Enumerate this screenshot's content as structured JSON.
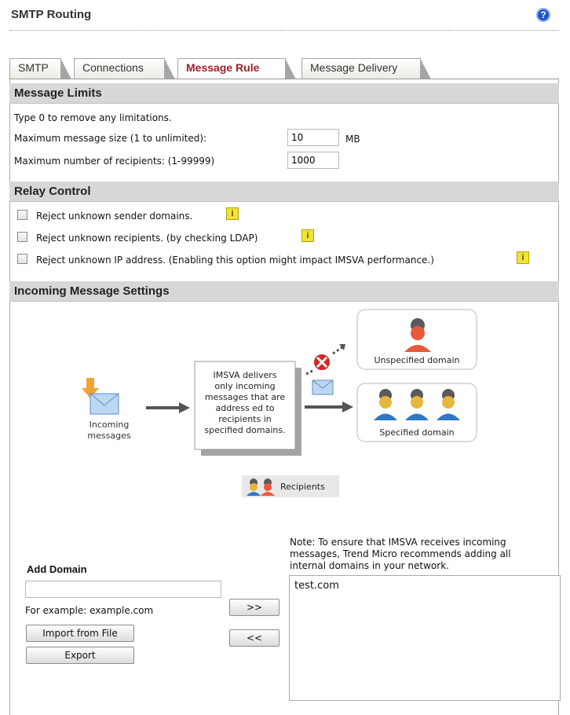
{
  "page": {
    "title": "SMTP Routing",
    "help_icon": "help-icon",
    "help_glyph": "?"
  },
  "tabs": [
    {
      "label": "SMTP"
    },
    {
      "label": "Connections"
    },
    {
      "label": "Message Rule",
      "active": true
    },
    {
      "label": "Message Delivery"
    }
  ],
  "message_limits": {
    "heading": "Message Limits",
    "hint": "Type 0 to remove any limitations.",
    "max_size_label": "Maximum message size (1 to unlimited):",
    "max_size_value": "10",
    "max_size_unit": "MB",
    "max_recipients_label": "Maximum number of recipients: (1-99999)",
    "max_recipients_value": "1000"
  },
  "relay_control": {
    "heading": "Relay Control",
    "options": [
      {
        "label": "Reject unknown sender domains.",
        "checked": false
      },
      {
        "label": "Reject unknown recipients. (by checking LDAP)",
        "checked": false
      },
      {
        "label": "Reject unknown IP address. (Enabling this option might impact IMSVA performance.)",
        "checked": false
      }
    ],
    "tip_glyph": "i"
  },
  "incoming": {
    "heading": "Incoming Message Settings",
    "diagram": {
      "incoming_label_1": "Incoming",
      "incoming_label_2": "messages",
      "center_lines": [
        "IMSVA delivers",
        "only incoming",
        "messages that are",
        "address ed to",
        "recipients in",
        "specified domains."
      ],
      "unspecified_label": "Unspecified domain",
      "specified_label": "Specified domain",
      "legend_label": "Recipients"
    },
    "add_domain_label": "Add Domain",
    "domain_input_value": "",
    "example_text": "For example: example.com",
    "import_button": "Import from File",
    "export_button": "Export",
    "add_button": ">>",
    "remove_button": "<<",
    "note": [
      "Note: To ensure that IMSVA receives incoming",
      "messages, Trend Micro recommends adding all",
      "internal domains in your network."
    ],
    "domains": [
      "test.com"
    ]
  },
  "colors": {
    "accent_tab": "#a0202c",
    "section_bg": "#d7d7d7",
    "tip": "#f1e23a"
  }
}
